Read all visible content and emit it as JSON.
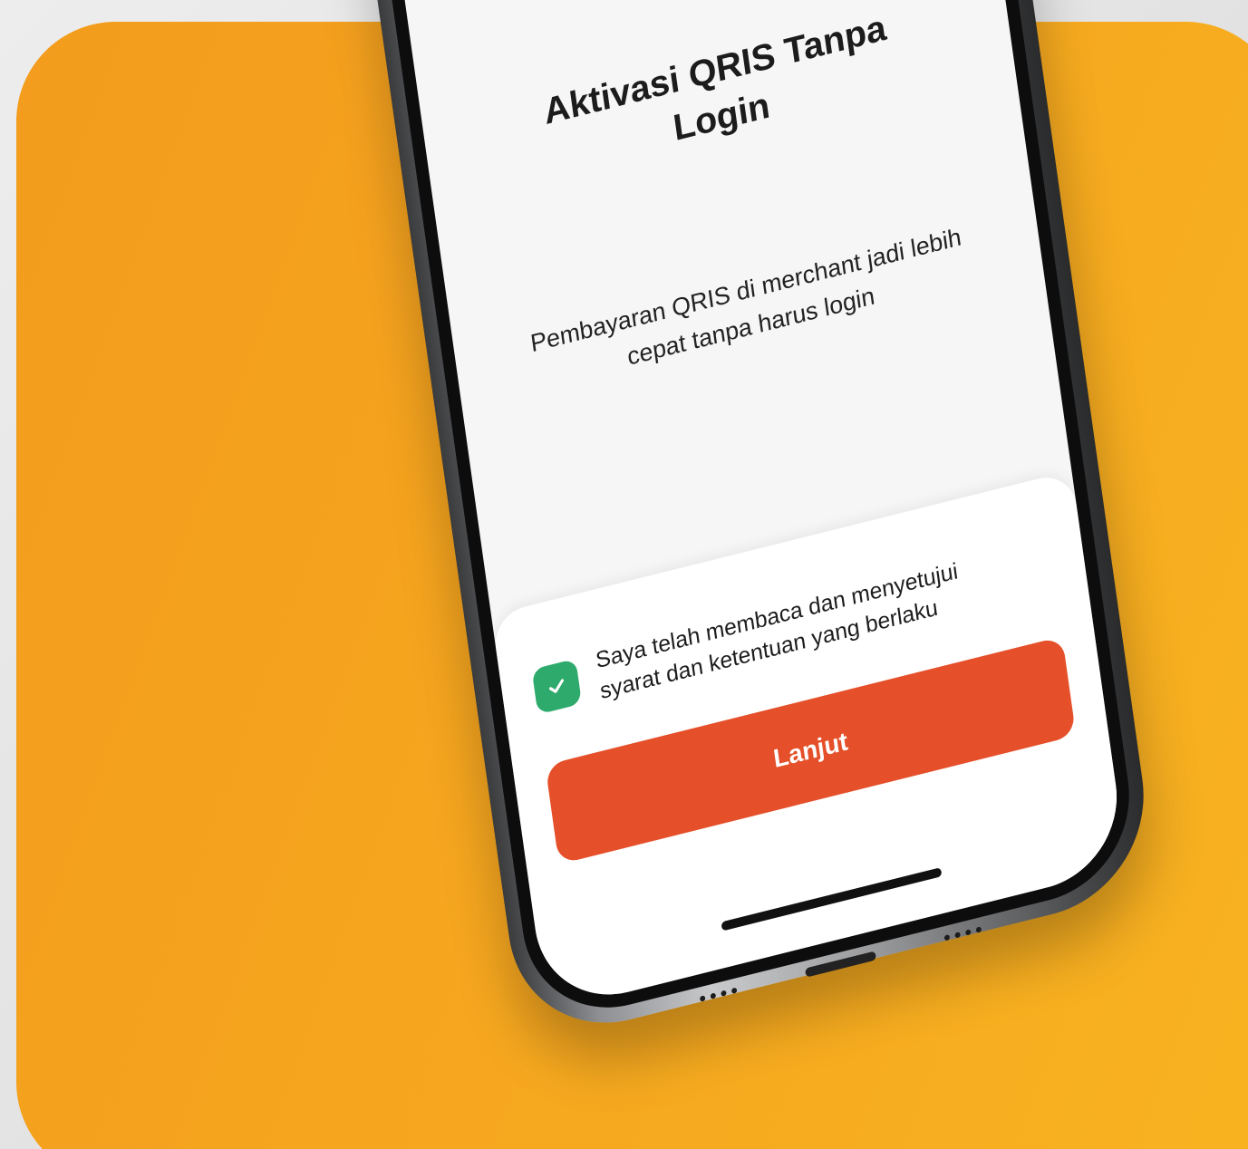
{
  "screen": {
    "title_lines": [
      "Aktivasi QRIS Tanpa",
      "Login"
    ],
    "subtitle_lines": [
      "Pembayaran QRIS di merchant jadi lebih",
      "cepat tanpa harus login"
    ]
  },
  "agreement": {
    "checked": true,
    "text_lines": [
      "Saya telah membaca dan menyetujui",
      "syarat dan ketentuan yang berlaku"
    ]
  },
  "cta": {
    "label": "Lanjut"
  },
  "colors": {
    "background_orange": "#f6a81f",
    "button": "#e5502a",
    "checkbox": "#2eaa6c"
  }
}
